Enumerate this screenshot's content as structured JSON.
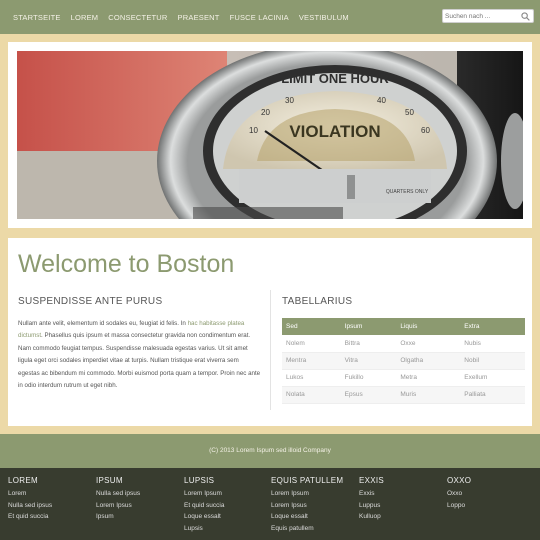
{
  "nav": {
    "items": [
      "STARTSEITE",
      "LOREM",
      "CONSECTETUR",
      "PRAESENT",
      "FUSCE LACINIA",
      "VESTIBULUM"
    ]
  },
  "search": {
    "placeholder": "Suchen nach ..."
  },
  "main": {
    "title": "Welcome to Boston",
    "left": {
      "heading": "SUSPENDISSE ANTE PURUS",
      "text_before": "Nullam ante velit, elementum id sodales eu, feugiat id felis. In ",
      "link": "hac habitasse platea dictumst",
      "text_after": ". Phasellus quis ipsum et massa consectetur gravida non condimentum erat. Nam commodo feugiat tempus. Suspendisse malesuada egestas varius. Ut sit amet ligula eget orci sodales imperdiet vitae at turpis. Nullam tristique erat viverra sem egestas ac bibendum mi commodo. Morbi euismod porta quam a tempor. Proin nec ante in odio interdum rutrum ut eget nibh."
    },
    "right": {
      "heading": "TABELLARIUS",
      "table": {
        "headers": [
          "Sed",
          "Ipsum",
          "Liquis",
          "Extra"
        ],
        "rows": [
          [
            "Nolem",
            "Bittra",
            "Oxxe",
            "Nubis"
          ],
          [
            "Mentra",
            "Vitra",
            "Olgatha",
            "Nobil"
          ],
          [
            "Lukos",
            "Fukillo",
            "Metra",
            "Exellum"
          ],
          [
            "Nolata",
            "Epsus",
            "Muris",
            "Palliata"
          ]
        ]
      }
    }
  },
  "copyright": "(C) 2013 Lorem Ispum sed illoid Company",
  "footer": {
    "columns": [
      {
        "heading": "LOREM",
        "items": [
          "Lorem",
          "Nulla sed ipsus",
          "Et quid succia"
        ]
      },
      {
        "heading": "IPSUM",
        "items": [
          "Nulla sed ipsus",
          "Lorem Ipsus",
          "Ipsum"
        ]
      },
      {
        "heading": "LUPSIS",
        "items": [
          "Lorem Ipsum",
          "Et quid succia",
          "Loque essalt",
          "Lupsis"
        ]
      },
      {
        "heading": "EQUIS PATULLEM",
        "items": [
          "Lorem Ipsum",
          "Lorem Ipsus",
          "Loque essalt",
          "Equis patullem"
        ]
      },
      {
        "heading": "EXXIS",
        "items": [
          "Exxis",
          "Luppus",
          "Kulluop"
        ]
      },
      {
        "heading": "OXXO",
        "items": [
          "Oxxo",
          "Loppo"
        ]
      }
    ]
  },
  "meter": {
    "top_text": "LIMIT ONE HOUR",
    "label": "VIOLATION",
    "numbers": [
      "10",
      "20",
      "30",
      "40",
      "50",
      "60"
    ],
    "small_text": "QUARTERS ONLY"
  },
  "colors": {
    "accent": "#8c9a70",
    "background": "#ecd9a7",
    "footer": "#383c2f"
  }
}
